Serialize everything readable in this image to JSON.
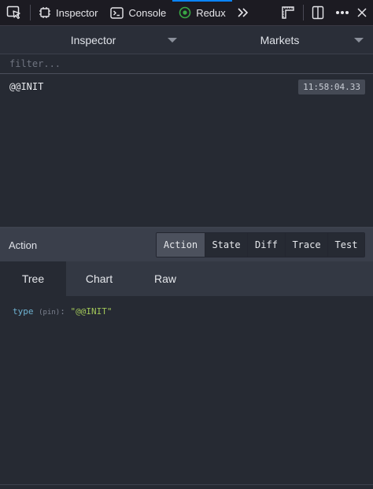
{
  "toolbar": {
    "tabs": [
      {
        "label": "Inspector",
        "icon": "inspector-icon"
      },
      {
        "label": "Console",
        "icon": "console-icon"
      },
      {
        "label": "Redux",
        "icon": "redux-icon"
      }
    ],
    "colors": {
      "active": "#0a84ff"
    }
  },
  "redux": {
    "left_select": "Inspector",
    "right_select": "Markets",
    "filter_placeholder": "filter...",
    "actions": [
      {
        "name": "@@INIT",
        "time": "11:58:04.33"
      }
    ]
  },
  "preview": {
    "title": "Action",
    "modes": [
      "Action",
      "State",
      "Diff",
      "Trace",
      "Test"
    ],
    "active_mode": "Action",
    "subtabs": [
      "Tree",
      "Chart",
      "Raw"
    ],
    "active_subtab": "Tree",
    "tree": {
      "key": "type",
      "pin": "(pin)",
      "colon": ":",
      "value": "\"@@INIT\""
    }
  }
}
